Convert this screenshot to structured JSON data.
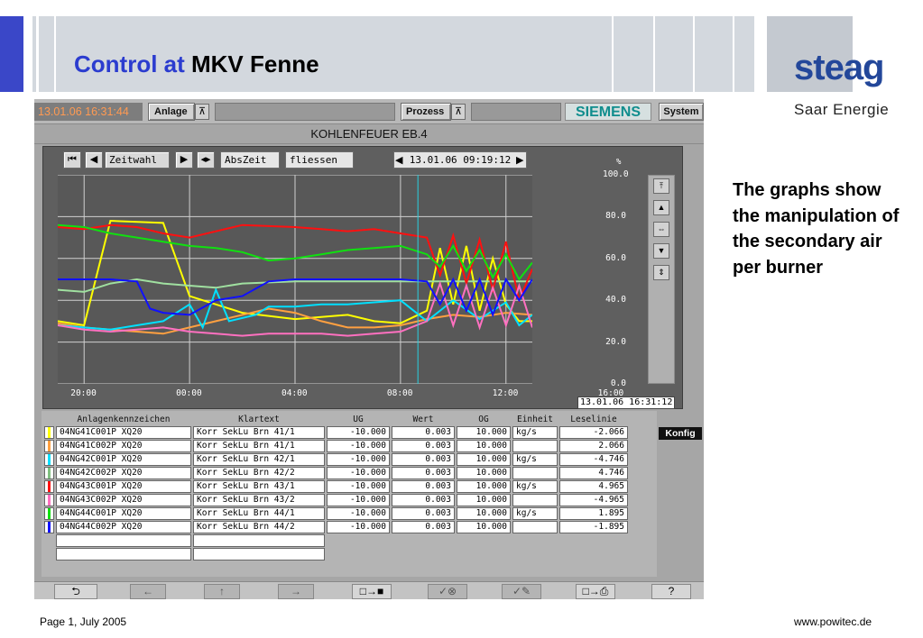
{
  "slide": {
    "title_part1": "Control at",
    "title_part2": "MKV Fenne",
    "logo_main": "steag",
    "logo_sub": "Saar Energie",
    "side_text": "The graphs show the manipulation of the secondary air per burner",
    "footer_left": "Page 1, July 2005",
    "footer_right": "www.powitec.de"
  },
  "scada": {
    "timestamp": "13.01.06 16:31:44",
    "anlage_label": "Anlage",
    "prozess_label": "Prozess",
    "siemens_label": "SIEMENS",
    "system_label": "System",
    "window_title": "KOHLENFEUER EB.4",
    "toolbar": {
      "zeitwahl": "Zeitwahl",
      "abszeit": "AbsZeit",
      "fliessen": "fliessen",
      "cursor_time": "13.01.06 09:19:12"
    },
    "y_unit": "%",
    "current_stamp": "13.01.06 16:31:12",
    "konfig_label": "Konfig"
  },
  "chart_data": {
    "type": "line",
    "ylim": [
      0,
      100
    ],
    "y_ticks": [
      "100.0",
      "80.0",
      "60.0",
      "40.0",
      "20.0",
      "0.0"
    ],
    "x_ticks": [
      "20:00",
      "00:00",
      "04:00",
      "08:00",
      "12:00",
      "16:00"
    ],
    "x_hours": [
      -18,
      18
    ],
    "cursor_hour": 9.32,
    "series": [
      {
        "name": "04NG41C001P XQ20",
        "color": "#ffff00",
        "points": [
          [
            -18,
            30
          ],
          [
            -16,
            28
          ],
          [
            -14,
            78
          ],
          [
            -10,
            77
          ],
          [
            -8,
            42
          ],
          [
            -6,
            38
          ],
          [
            -4,
            34
          ],
          [
            0,
            31
          ],
          [
            2,
            32
          ],
          [
            4,
            33
          ],
          [
            6,
            30
          ],
          [
            8,
            29
          ],
          [
            10,
            35
          ],
          [
            11,
            65
          ],
          [
            12,
            38
          ],
          [
            13,
            66
          ],
          [
            14,
            35
          ],
          [
            15,
            60
          ],
          [
            16,
            38
          ],
          [
            17,
            30
          ],
          [
            18,
            30
          ]
        ]
      },
      {
        "name": "04NG41C002P XQ20",
        "color": "#ffa040",
        "points": [
          [
            -18,
            29
          ],
          [
            -16,
            27
          ],
          [
            -14,
            26
          ],
          [
            -10,
            24
          ],
          [
            -6,
            30
          ],
          [
            -2,
            36
          ],
          [
            0,
            34
          ],
          [
            2,
            30
          ],
          [
            4,
            27
          ],
          [
            6,
            27
          ],
          [
            8,
            28
          ],
          [
            10,
            31
          ],
          [
            12,
            33
          ],
          [
            14,
            32
          ],
          [
            16,
            34
          ],
          [
            18,
            33
          ]
        ]
      },
      {
        "name": "04NG42C001P XQ20",
        "color": "#00e0ff",
        "points": [
          [
            -18,
            28
          ],
          [
            -16,
            27
          ],
          [
            -14,
            26
          ],
          [
            -12,
            28
          ],
          [
            -10,
            30
          ],
          [
            -8,
            38
          ],
          [
            -7,
            27
          ],
          [
            -6,
            45
          ],
          [
            -5,
            30
          ],
          [
            -3,
            33
          ],
          [
            -2,
            37
          ],
          [
            0,
            37
          ],
          [
            2,
            38
          ],
          [
            4,
            38
          ],
          [
            6,
            39
          ],
          [
            8,
            40
          ],
          [
            10,
            30
          ],
          [
            12,
            40
          ],
          [
            14,
            31
          ],
          [
            16,
            39
          ],
          [
            17,
            28
          ],
          [
            18,
            33
          ]
        ]
      },
      {
        "name": "04NG42C002P XQ20",
        "color": "#a0e0a0",
        "points": [
          [
            -18,
            45
          ],
          [
            -16,
            44
          ],
          [
            -14,
            48
          ],
          [
            -12,
            50
          ],
          [
            -10,
            48
          ],
          [
            -8,
            47
          ],
          [
            -6,
            46
          ],
          [
            -4,
            48
          ],
          [
            0,
            49
          ],
          [
            4,
            49
          ],
          [
            8,
            49
          ],
          [
            12,
            49
          ],
          [
            16,
            49
          ],
          [
            18,
            49
          ]
        ]
      },
      {
        "name": "04NG43C001P XQ20",
        "color": "#ff1010",
        "points": [
          [
            -18,
            75
          ],
          [
            -16,
            74
          ],
          [
            -14,
            76
          ],
          [
            -12,
            75
          ],
          [
            -10,
            72
          ],
          [
            -8,
            70
          ],
          [
            -4,
            76
          ],
          [
            0,
            75
          ],
          [
            2,
            74
          ],
          [
            4,
            73
          ],
          [
            6,
            74
          ],
          [
            8,
            72
          ],
          [
            10,
            70
          ],
          [
            11,
            52
          ],
          [
            12,
            71
          ],
          [
            13,
            48
          ],
          [
            14,
            69
          ],
          [
            15,
            45
          ],
          [
            16,
            68
          ],
          [
            17,
            40
          ],
          [
            18,
            55
          ]
        ]
      },
      {
        "name": "04NG43C002P XQ20",
        "color": "#ff70c0",
        "points": [
          [
            -18,
            28
          ],
          [
            -16,
            26
          ],
          [
            -14,
            25
          ],
          [
            -12,
            26
          ],
          [
            -10,
            27
          ],
          [
            -8,
            25
          ],
          [
            -6,
            24
          ],
          [
            -4,
            23
          ],
          [
            -2,
            24
          ],
          [
            0,
            24
          ],
          [
            2,
            24
          ],
          [
            4,
            23
          ],
          [
            6,
            24
          ],
          [
            8,
            25
          ],
          [
            10,
            30
          ],
          [
            11,
            48
          ],
          [
            12,
            28
          ],
          [
            13,
            47
          ],
          [
            14,
            27
          ],
          [
            15,
            46
          ],
          [
            16,
            28
          ],
          [
            17,
            47
          ],
          [
            18,
            27
          ]
        ]
      },
      {
        "name": "04NG44C001P XQ20",
        "color": "#10e010",
        "points": [
          [
            -18,
            76
          ],
          [
            -16,
            75
          ],
          [
            -14,
            72
          ],
          [
            -12,
            70
          ],
          [
            -10,
            68
          ],
          [
            -8,
            66
          ],
          [
            -6,
            65
          ],
          [
            -4,
            63
          ],
          [
            -2,
            59
          ],
          [
            0,
            60
          ],
          [
            2,
            62
          ],
          [
            4,
            64
          ],
          [
            6,
            65
          ],
          [
            8,
            66
          ],
          [
            10,
            62
          ],
          [
            11,
            56
          ],
          [
            12,
            66
          ],
          [
            13,
            54
          ],
          [
            14,
            64
          ],
          [
            15,
            51
          ],
          [
            16,
            62
          ],
          [
            17,
            50
          ],
          [
            18,
            58
          ]
        ]
      },
      {
        "name": "04NG44C002P XQ20",
        "color": "#1010ff",
        "points": [
          [
            -18,
            50
          ],
          [
            -16,
            50
          ],
          [
            -14,
            50
          ],
          [
            -12,
            49
          ],
          [
            -11,
            36
          ],
          [
            -10,
            34
          ],
          [
            -8,
            33
          ],
          [
            -6,
            40
          ],
          [
            -4,
            42
          ],
          [
            -2,
            49
          ],
          [
            0,
            50
          ],
          [
            4,
            50
          ],
          [
            8,
            50
          ],
          [
            10,
            49
          ],
          [
            11,
            38
          ],
          [
            12,
            50
          ],
          [
            13,
            35
          ],
          [
            14,
            50
          ],
          [
            15,
            33
          ],
          [
            16,
            50
          ],
          [
            17,
            40
          ],
          [
            18,
            50
          ]
        ]
      }
    ]
  },
  "table": {
    "headers": [
      "Anlagenkennzeichen",
      "Klartext",
      "UG",
      "Wert",
      "OG",
      "Einheit",
      "Leselinie"
    ],
    "rows": [
      {
        "color": "#ffff00",
        "tag": "04NG41C001P XQ20",
        "text": "Korr SekLu Brn 41/1",
        "ug": "-10.000",
        "wert": "0.003",
        "og": "10.000",
        "unit": "kg/s",
        "lese": "-2.066"
      },
      {
        "color": "#ffa040",
        "tag": "04NG41C002P XQ20",
        "text": "Korr SekLu Brn 41/1",
        "ug": "-10.000",
        "wert": "0.003",
        "og": "10.000",
        "unit": "",
        "lese": "2.066"
      },
      {
        "color": "#00e0ff",
        "tag": "04NG42C001P XQ20",
        "text": "Korr SekLu Brn 42/1",
        "ug": "-10.000",
        "wert": "0.003",
        "og": "10.000",
        "unit": "kg/s",
        "lese": "-4.746"
      },
      {
        "color": "#80c080",
        "tag": "04NG42C002P XQ20",
        "text": "Korr SekLu Brn 42/2",
        "ug": "-10.000",
        "wert": "0.003",
        "og": "10.000",
        "unit": "",
        "lese": "4.746"
      },
      {
        "color": "#ff1010",
        "tag": "04NG43C001P XQ20",
        "text": "Korr SekLu Brn 43/1",
        "ug": "-10.000",
        "wert": "0.003",
        "og": "10.000",
        "unit": "kg/s",
        "lese": "4.965"
      },
      {
        "color": "#ff70c0",
        "tag": "04NG43C002P XQ20",
        "text": "Korr SekLu Brn 43/2",
        "ug": "-10.000",
        "wert": "0.003",
        "og": "10.000",
        "unit": "",
        "lese": "-4.965"
      },
      {
        "color": "#10e010",
        "tag": "04NG44C001P XQ20",
        "text": "Korr SekLu Brn 44/1",
        "ug": "-10.000",
        "wert": "0.003",
        "og": "10.000",
        "unit": "kg/s",
        "lese": "1.895"
      },
      {
        "color": "#1010ff",
        "tag": "04NG44C002P XQ20",
        "text": "Korr SekLu Brn 44/2",
        "ug": "-10.000",
        "wert": "0.003",
        "og": "10.000",
        "unit": "",
        "lese": "-1.895"
      }
    ]
  },
  "bottom_bar": {
    "undo": "⮌",
    "back": "←",
    "up": "↑",
    "forward": "→",
    "export": "□→■",
    "ok_x": "✓⊗",
    "ok_pen": "✓✎",
    "print": "□→⎙",
    "help": "?"
  }
}
